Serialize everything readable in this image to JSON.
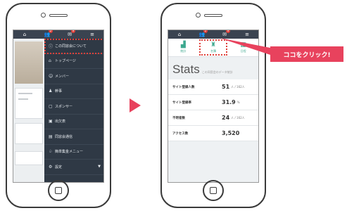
{
  "left_phone": {
    "nav_icons": [
      "home-icon",
      "users-icon",
      "chat-icon",
      "menu-icon"
    ],
    "nav_badges": [
      "",
      "2",
      "9",
      ""
    ],
    "menu_items": [
      {
        "label": "この同窓会について",
        "icon": "info-icon",
        "active": true
      },
      {
        "label": "トップページ",
        "icon": "home-icon",
        "active": false
      },
      {
        "label": "メンバー",
        "icon": "member-icon",
        "active": false
      },
      {
        "label": "幹事",
        "icon": "organizer-icon",
        "active": false
      },
      {
        "label": "スポンサー",
        "icon": "sponsor-icon",
        "active": false
      },
      {
        "label": "出欠表",
        "icon": "calendar-icon",
        "active": false
      },
      {
        "label": "同窓会通信",
        "icon": "newsletter-icon",
        "active": false
      },
      {
        "label": "簡単集金メニュー",
        "icon": "money-icon",
        "active": false
      },
      {
        "label": "設定",
        "icon": "settings-icon",
        "active": false
      }
    ]
  },
  "right_phone": {
    "nav_icons": [
      "home-icon",
      "users-icon",
      "chat-icon",
      "menu-icon"
    ],
    "nav_badges": [
      "",
      "2",
      "9",
      ""
    ],
    "tabs": [
      {
        "label": "統計",
        "icon": "chart-icon",
        "active": false
      },
      {
        "label": "名簿",
        "icon": "people-icon",
        "active": true
      },
      {
        "label": "日程",
        "icon": "calendar-icon",
        "active": false
      }
    ],
    "stats_title": "Stats",
    "stats_subtitle": "この同窓会のデータ統計",
    "stats": [
      {
        "label": "サイト登録人数",
        "value": "51",
        "unit": "人 / 162人"
      },
      {
        "label": "サイト登録率",
        "value": "31.9",
        "unit": "%"
      },
      {
        "label": "不明者数",
        "value": "24",
        "unit": "人 / 162人"
      },
      {
        "label": "アクセス数",
        "value": "3,520",
        "unit": ""
      }
    ]
  },
  "callout": {
    "text": "ココをクリック!",
    "color": "#e8425d"
  },
  "colors": {
    "accent": "#e8425d",
    "navbar": "#3a4350",
    "menu_bg": "#2f3945",
    "tab_icon": "#3da88f",
    "highlight": "#e0403a"
  }
}
